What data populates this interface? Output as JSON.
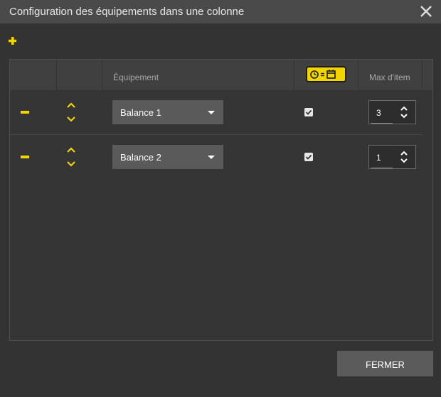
{
  "dialog": {
    "title": "Configuration des équipements dans une colonne",
    "close_icon": "close-icon",
    "add_icon": "plus-icon"
  },
  "table": {
    "headers": {
      "equipment": "Équipement",
      "timer_calendar_icon": "clock-equals-calendar-icon",
      "max_items": "Max d'item"
    },
    "rows": [
      {
        "equipment": "Balance 1",
        "checked": true,
        "max": "3"
      },
      {
        "equipment": "Balance 2",
        "checked": true,
        "max": "1"
      }
    ]
  },
  "footer": {
    "close_label": "FERMER"
  },
  "colors": {
    "accent": "#f2d400",
    "background": "#333333",
    "titlebar": "#4a4a4a",
    "select": "#5a5a5a"
  }
}
